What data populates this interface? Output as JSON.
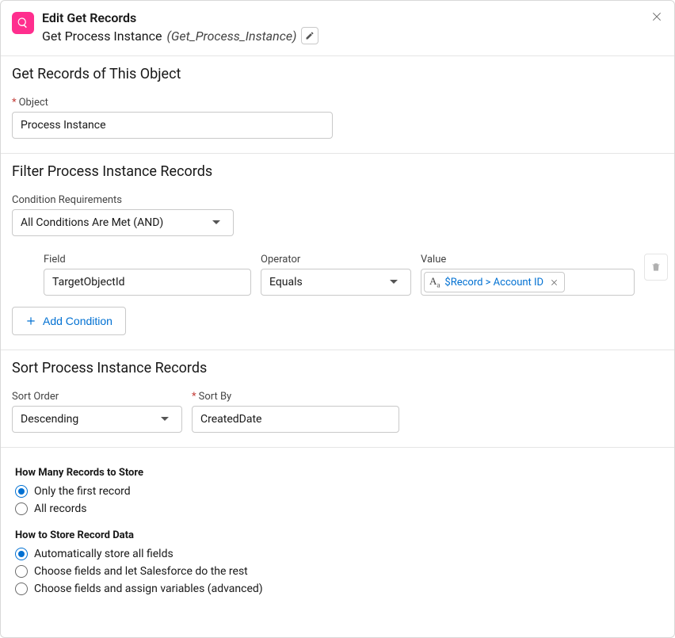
{
  "header": {
    "title": "Edit Get Records",
    "label": "Get Process Instance",
    "api_name": "(Get_Process_Instance)"
  },
  "objectSection": {
    "title": "Get Records of This Object",
    "object_label": "Object",
    "object_value": "Process Instance"
  },
  "filterSection": {
    "title": "Filter Process Instance Records",
    "condition_req_label": "Condition Requirements",
    "condition_req_value": "All Conditions Are Met (AND)",
    "row": {
      "field_label": "Field",
      "field_value": "TargetObjectId",
      "operator_label": "Operator",
      "operator_value": "Equals",
      "value_label": "Value",
      "value_pill": "$Record > Account ID"
    },
    "add_condition_label": "Add Condition"
  },
  "sortSection": {
    "title": "Sort Process Instance Records",
    "sort_order_label": "Sort Order",
    "sort_order_value": "Descending",
    "sort_by_label": "Sort By",
    "sort_by_value": "CreatedDate"
  },
  "storeSection": {
    "how_many_heading": "How Many Records to Store",
    "how_many_options": [
      "Only the first record",
      "All records"
    ],
    "how_many_selected": 0,
    "how_store_heading": "How to Store Record Data",
    "how_store_options": [
      "Automatically store all fields",
      "Choose fields and let Salesforce do the rest",
      "Choose fields and assign variables (advanced)"
    ],
    "how_store_selected": 0
  }
}
